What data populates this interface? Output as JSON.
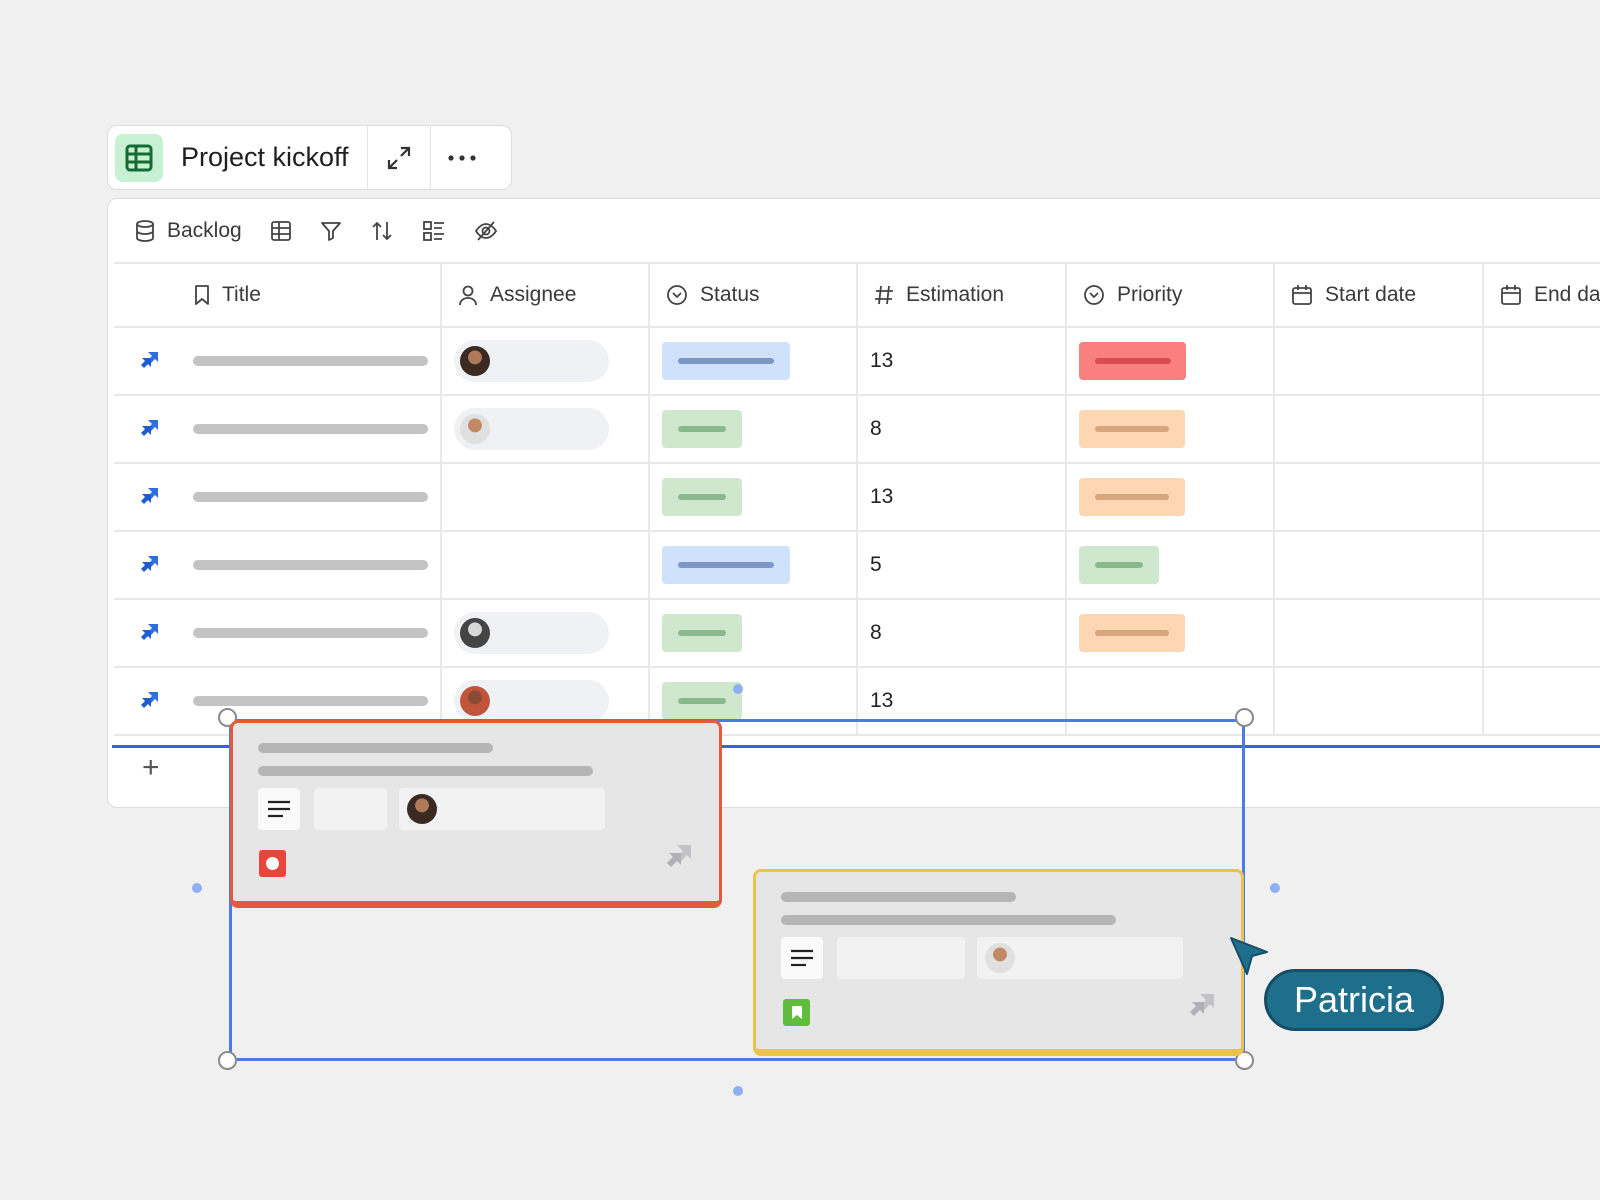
{
  "header": {
    "title": "Project kickoff",
    "icons": [
      "table-icon",
      "expand-icon",
      "more-icon"
    ]
  },
  "toolbar": {
    "backlog_label": "Backlog",
    "icons": [
      "database-icon",
      "table-view-icon",
      "filter-icon",
      "sort-icon",
      "group-icon",
      "hide-icon"
    ]
  },
  "table": {
    "columns": [
      "Title",
      "Assignee",
      "Status",
      "Estimation",
      "Priority",
      "Start date",
      "End da"
    ],
    "rows": [
      {
        "estimation": "13",
        "status": "blue",
        "priority": "red",
        "assignee": true
      },
      {
        "estimation": "8",
        "status": "green",
        "priority": "orange",
        "assignee": true
      },
      {
        "estimation": "13",
        "status": "green",
        "priority": "orange",
        "assignee": false
      },
      {
        "estimation": "5",
        "status": "blue",
        "priority": "green",
        "assignee": false
      },
      {
        "estimation": "8",
        "status": "green",
        "priority": "orange",
        "assignee": true
      },
      {
        "estimation": "13",
        "status": "green",
        "priority": "",
        "assignee": true
      }
    ],
    "add_row_label": "+"
  },
  "cursor": {
    "user_name": "Patricia",
    "color": "#1e6f8c"
  },
  "colors": {
    "card1_border": "#e35a3f",
    "card2_border": "#ecc24e",
    "selection": "#4b7be9"
  }
}
